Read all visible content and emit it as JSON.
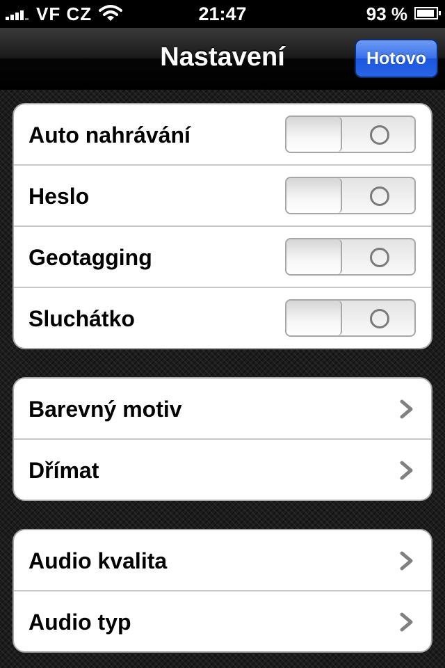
{
  "status_bar": {
    "carrier": "VF CZ",
    "time": "21:47",
    "battery_percent": "93 %",
    "battery_level": 0.93
  },
  "nav": {
    "title": "Nastavení",
    "done_label": "Hotovo"
  },
  "groups": [
    {
      "rows": [
        {
          "label": "Auto nahrávání",
          "control": "switch",
          "on": false
        },
        {
          "label": "Heslo",
          "control": "switch",
          "on": false
        },
        {
          "label": "Geotagging",
          "control": "switch",
          "on": false
        },
        {
          "label": "Sluchátko",
          "control": "switch",
          "on": false
        }
      ]
    },
    {
      "rows": [
        {
          "label": "Barevný motiv",
          "control": "disclosure"
        },
        {
          "label": "Dřímat",
          "control": "disclosure"
        }
      ]
    },
    {
      "rows": [
        {
          "label": "Audio kvalita",
          "control": "disclosure"
        },
        {
          "label": "Audio typ",
          "control": "disclosure"
        }
      ]
    }
  ],
  "colors": {
    "done_button": "#2a64e6",
    "switch_off_mark": "#7a7a7a",
    "chevron": "#808080"
  }
}
